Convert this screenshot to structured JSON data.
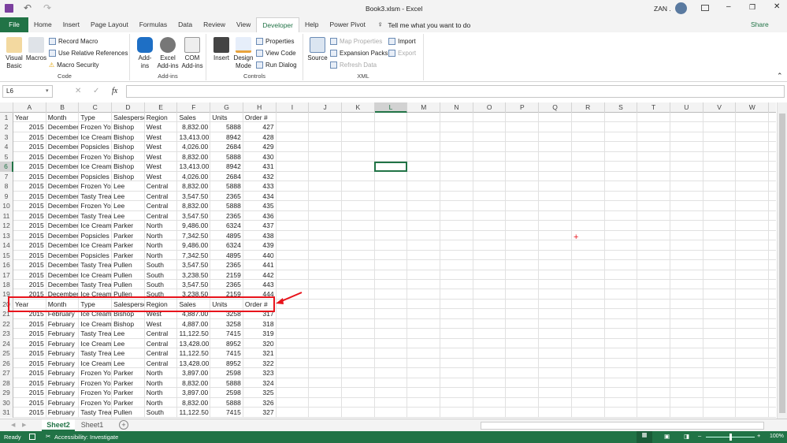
{
  "window": {
    "title": "Book3.xlsm  -  Excel",
    "user": "ZAN .",
    "share": "Share"
  },
  "tabs": [
    "File",
    "Home",
    "Insert",
    "Page Layout",
    "Formulas",
    "Data",
    "Review",
    "View",
    "Developer",
    "Help",
    "Power Pivot"
  ],
  "active_tab": "Developer",
  "tell_me": "Tell me what you want to do",
  "ribbon": {
    "code": {
      "label": "Code",
      "visual_basic": "Visual Basic",
      "macros": "Macros",
      "record_macro": "Record Macro",
      "relative": "Use Relative References",
      "security": "Macro Security"
    },
    "addins": {
      "label": "Add-ins",
      "addins": "Add-ins",
      "excel_addins": "Excel Add-ins",
      "com_addins": "COM Add-ins"
    },
    "controls": {
      "label": "Controls",
      "insert": "Insert",
      "design_mode": "Design Mode",
      "properties": "Properties",
      "view_code": "View Code",
      "run_dialog": "Run Dialog"
    },
    "xml": {
      "label": "XML",
      "source": "Source",
      "map_properties": "Map Properties",
      "expansion_packs": "Expansion Packs",
      "refresh_data": "Refresh Data",
      "import": "Import",
      "export": "Export"
    }
  },
  "name_box": "L6",
  "fx": "fx",
  "columns": [
    "A",
    "B",
    "C",
    "D",
    "E",
    "F",
    "G",
    "H",
    "I",
    "J",
    "K",
    "L",
    "M",
    "N",
    "O",
    "P",
    "Q",
    "R",
    "S",
    "T",
    "U",
    "V",
    "W"
  ],
  "selected_cell": {
    "col": "L",
    "row": 6
  },
  "rows": [
    [
      "Year",
      "Month",
      "Type",
      "Salesperso",
      "Region",
      "Sales",
      "Units",
      "Order #"
    ],
    [
      "2015",
      "December",
      "Frozen Yog",
      "Bishop",
      "West",
      "8,832.00",
      "5888",
      "427"
    ],
    [
      "2015",
      "December",
      "Ice Cream",
      "Bishop",
      "West",
      "13,413.00",
      "8942",
      "428"
    ],
    [
      "2015",
      "December",
      "Popsicles",
      "Bishop",
      "West",
      "4,026.00",
      "2684",
      "429"
    ],
    [
      "2015",
      "December",
      "Frozen Yog",
      "Bishop",
      "West",
      "8,832.00",
      "5888",
      "430"
    ],
    [
      "2015",
      "December",
      "Ice Cream",
      "Bishop",
      "West",
      "13,413.00",
      "8942",
      "431"
    ],
    [
      "2015",
      "December",
      "Popsicles",
      "Bishop",
      "West",
      "4,026.00",
      "2684",
      "432"
    ],
    [
      "2015",
      "December",
      "Frozen Yog",
      "Lee",
      "Central",
      "8,832.00",
      "5888",
      "433"
    ],
    [
      "2015",
      "December",
      "Tasty Trea",
      "Lee",
      "Central",
      "3,547.50",
      "2365",
      "434"
    ],
    [
      "2015",
      "December",
      "Frozen Yog",
      "Lee",
      "Central",
      "8,832.00",
      "5888",
      "435"
    ],
    [
      "2015",
      "December",
      "Tasty Trea",
      "Lee",
      "Central",
      "3,547.50",
      "2365",
      "436"
    ],
    [
      "2015",
      "December",
      "Ice Cream",
      "Parker",
      "North",
      "9,486.00",
      "6324",
      "437"
    ],
    [
      "2015",
      "December",
      "Popsicles",
      "Parker",
      "North",
      "7,342.50",
      "4895",
      "438"
    ],
    [
      "2015",
      "December",
      "Ice Cream",
      "Parker",
      "North",
      "9,486.00",
      "6324",
      "439"
    ],
    [
      "2015",
      "December",
      "Popsicles",
      "Parker",
      "North",
      "7,342.50",
      "4895",
      "440"
    ],
    [
      "2015",
      "December",
      "Tasty Trea",
      "Pullen",
      "South",
      "3,547.50",
      "2365",
      "441"
    ],
    [
      "2015",
      "December",
      "Ice Cream",
      "Pullen",
      "South",
      "3,238.50",
      "2159",
      "442"
    ],
    [
      "2015",
      "December",
      "Tasty Trea",
      "Pullen",
      "South",
      "3,547.50",
      "2365",
      "443"
    ],
    [
      "2015",
      "December",
      "Ice Cream",
      "Pullen",
      "South",
      "3,238.50",
      "2159",
      "444"
    ],
    [
      "Year",
      "Month",
      "Type",
      "Salesperso",
      "Region",
      "Sales",
      "Units",
      "Order #"
    ],
    [
      "2015",
      "February",
      "Ice Cream",
      "Bishop",
      "West",
      "4,887.00",
      "3258",
      "317"
    ],
    [
      "2015",
      "February",
      "Ice Cream",
      "Bishop",
      "West",
      "4,887.00",
      "3258",
      "318"
    ],
    [
      "2015",
      "February",
      "Tasty Trea",
      "Lee",
      "Central",
      "11,122.50",
      "7415",
      "319"
    ],
    [
      "2015",
      "February",
      "Ice Cream",
      "Lee",
      "Central",
      "13,428.00",
      "8952",
      "320"
    ],
    [
      "2015",
      "February",
      "Tasty Trea",
      "Lee",
      "Central",
      "11,122.50",
      "7415",
      "321"
    ],
    [
      "2015",
      "February",
      "Ice Cream",
      "Lee",
      "Central",
      "13,428.00",
      "8952",
      "322"
    ],
    [
      "2015",
      "February",
      "Frozen Yog",
      "Parker",
      "North",
      "3,897.00",
      "2598",
      "323"
    ],
    [
      "2015",
      "February",
      "Frozen Yog",
      "Parker",
      "North",
      "8,832.00",
      "5888",
      "324"
    ],
    [
      "2015",
      "February",
      "Frozen Yog",
      "Parker",
      "North",
      "3,897.00",
      "2598",
      "325"
    ],
    [
      "2015",
      "February",
      "Frozen Yog",
      "Parker",
      "North",
      "8,832.00",
      "5888",
      "326"
    ],
    [
      "2015",
      "February",
      "Tasty Trea",
      "Pullen",
      "South",
      "11,122.50",
      "7415",
      "327"
    ]
  ],
  "sheets": [
    "Sheet2",
    "Sheet1"
  ],
  "active_sheet": "Sheet2",
  "status": {
    "ready": "Ready",
    "accessibility": "Accessibility: Investigate",
    "zoom": "100%"
  },
  "colors": {
    "excel_green": "#217346",
    "annotation_red": "#e8141c"
  }
}
